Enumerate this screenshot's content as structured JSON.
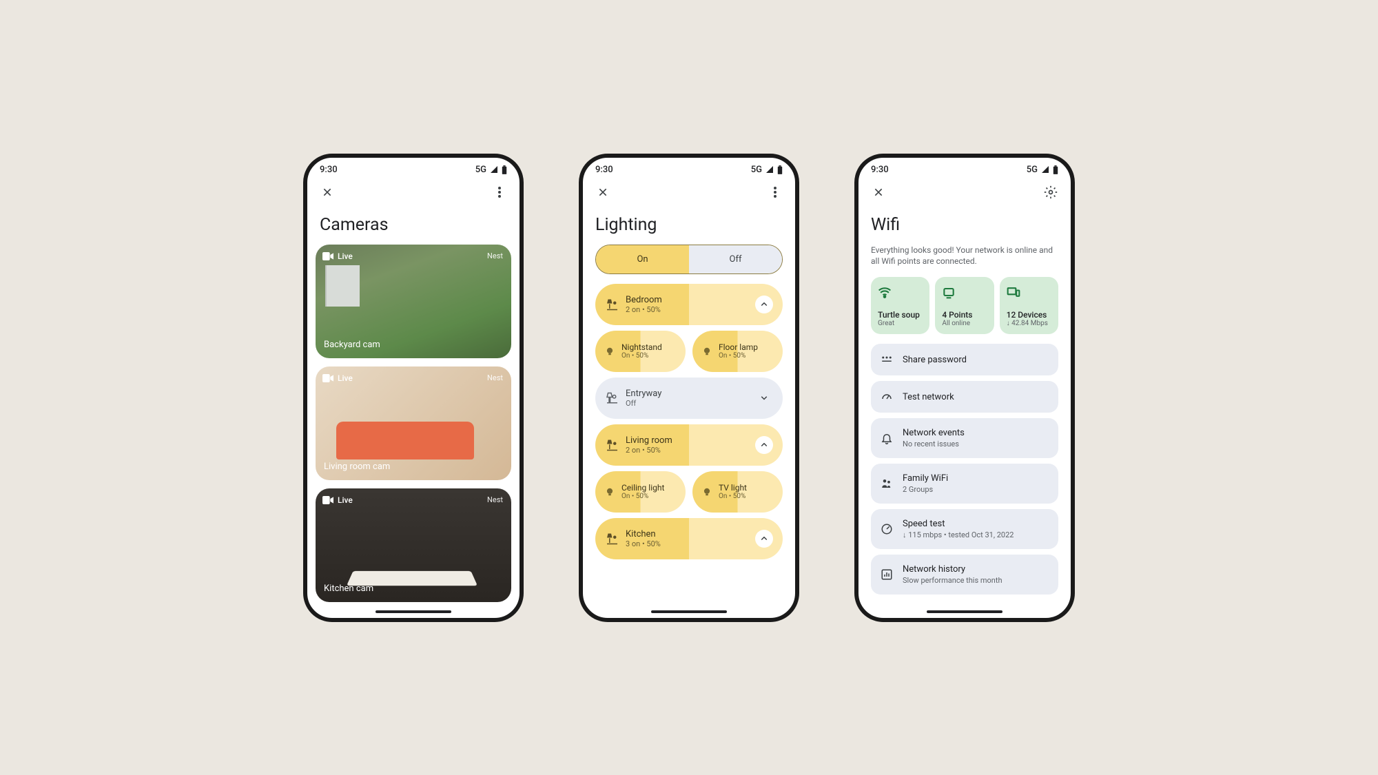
{
  "statusbar": {
    "time": "9:30",
    "network": "5G"
  },
  "screens": {
    "cameras": {
      "title": "Cameras",
      "items": [
        {
          "status": "Live",
          "brand": "Nest",
          "label": "Backyard cam"
        },
        {
          "status": "Live",
          "brand": "Nest",
          "label": "Living room cam"
        },
        {
          "status": "Live",
          "brand": "Nest",
          "label": "Kitchen cam"
        }
      ]
    },
    "lighting": {
      "title": "Lighting",
      "seg_on": "On",
      "seg_off": "Off",
      "rooms": [
        {
          "name": "Bedroom",
          "sub": "2 on • 50%",
          "on": true,
          "expanded": true,
          "children": [
            {
              "name": "Nightstand",
              "sub": "On • 50%"
            },
            {
              "name": "Floor lamp",
              "sub": "On • 50%"
            }
          ]
        },
        {
          "name": "Entryway",
          "sub": "Off",
          "on": false,
          "expanded": false
        },
        {
          "name": "Living room",
          "sub": "2 on • 50%",
          "on": true,
          "expanded": true,
          "children": [
            {
              "name": "Ceiling light",
              "sub": "On • 50%"
            },
            {
              "name": "TV light",
              "sub": "On • 50%"
            }
          ]
        },
        {
          "name": "Kitchen",
          "sub": "3 on • 50%",
          "on": true,
          "expanded": true
        }
      ]
    },
    "wifi": {
      "title": "Wifi",
      "subtitle": "Everything looks good! Your network is online and all Wifi points are connected.",
      "cards": [
        {
          "title": "Turtle soup",
          "sub": "Great"
        },
        {
          "title": "4 Points",
          "sub": "All online"
        },
        {
          "title": "12 Devices",
          "sub": "↓ 42.84 Mbps"
        }
      ],
      "items": [
        {
          "name": "Share password",
          "sub": ""
        },
        {
          "name": "Test network",
          "sub": ""
        },
        {
          "name": "Network events",
          "sub": "No recent issues"
        },
        {
          "name": "Family WiFi",
          "sub": "2 Groups"
        },
        {
          "name": "Speed test",
          "sub": "↓ 115 mbps • tested Oct 31, 2022"
        },
        {
          "name": "Network history",
          "sub": "Slow performance this month"
        }
      ]
    }
  }
}
